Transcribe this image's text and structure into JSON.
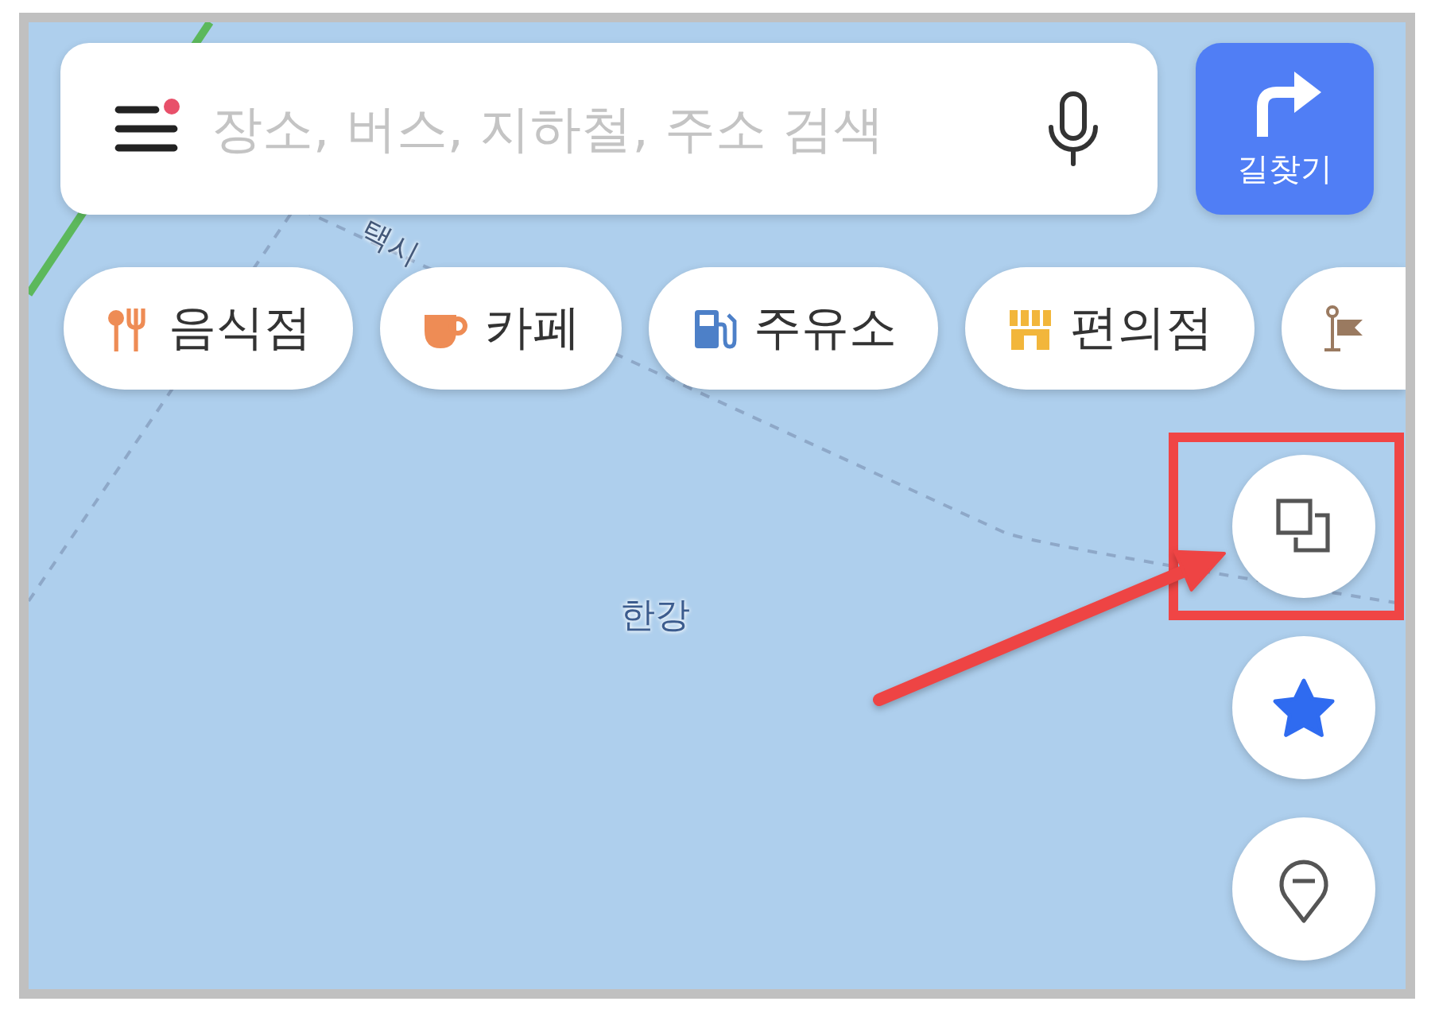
{
  "search_bar": {
    "placeholder": "장소, 버스, 지하철, 주소 검색",
    "menu_badge": true
  },
  "directions_button": {
    "label": "길찾기"
  },
  "category_chips": [
    {
      "label": "음식점",
      "kind": "restaurant"
    },
    {
      "label": "카페",
      "kind": "cafe"
    },
    {
      "label": "주유소",
      "kind": "gas"
    },
    {
      "label": "편의점",
      "kind": "store"
    },
    {
      "kind": "landmark"
    }
  ],
  "map": {
    "labels": [
      {
        "text": "택시",
        "kind": "road"
      },
      {
        "text": "한강",
        "kind": "area"
      }
    ]
  },
  "map_controls": [
    {
      "kind": "layers",
      "highlighted": true
    },
    {
      "kind": "favorites",
      "highlighted": false
    },
    {
      "kind": "pin",
      "highlighted": false
    }
  ]
}
